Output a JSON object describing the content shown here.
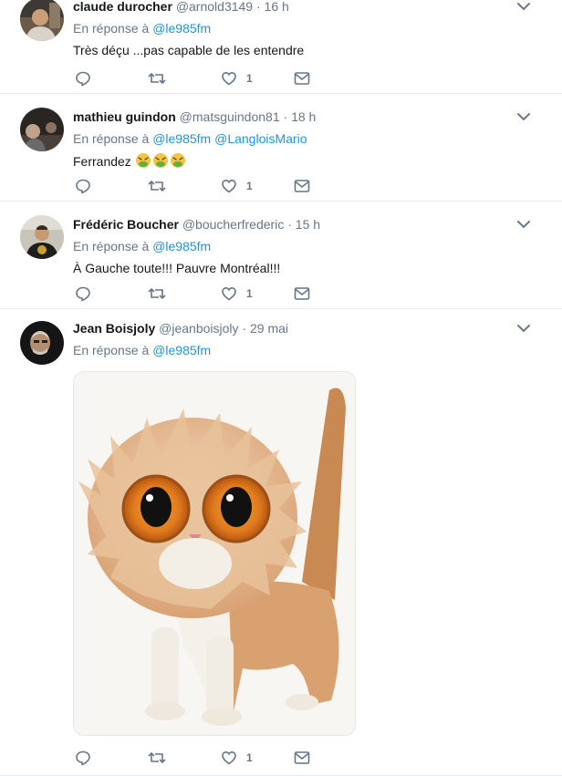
{
  "tweets": [
    {
      "fullname": "claude durocher",
      "username": "@arnold3149",
      "time": "16 h",
      "reply_prefix": "En réponse à",
      "mentions": [
        "@le985fm"
      ],
      "text": "Très déçu ...pas capable de les entendre",
      "likes": "1",
      "avatar": "avatar-icon"
    },
    {
      "fullname": "mathieu guindon",
      "username": "@matsguindon81",
      "time": "18 h",
      "reply_prefix": "En réponse à",
      "mentions": [
        "@le985fm",
        "@LangloisMario"
      ],
      "text": "Ferrandez",
      "text_emoji": "nauseated-face-icon",
      "likes": "1",
      "avatar": "avatar-icon"
    },
    {
      "fullname": "Frédéric Boucher",
      "username": "@boucherfrederic",
      "time": "15 h",
      "reply_prefix": "En réponse à",
      "mentions": [
        "@le985fm"
      ],
      "text": "À Gauche toute!!! Pauvre Montréal!!!",
      "likes": "1",
      "avatar": "avatar-icon"
    },
    {
      "fullname": "Jean Boisjoly",
      "username": "@jeanboisjoly",
      "time": "29 mai",
      "reply_prefix": "En réponse à",
      "mentions": [
        "@le985fm"
      ],
      "media": "cat-image",
      "likes": "1",
      "avatar": "avatar-icon"
    }
  ],
  "separator": "·",
  "colors": {
    "link": "#1b95e0",
    "secondary": "#657786",
    "text": "#14171a",
    "border": "#e6ecf0"
  }
}
